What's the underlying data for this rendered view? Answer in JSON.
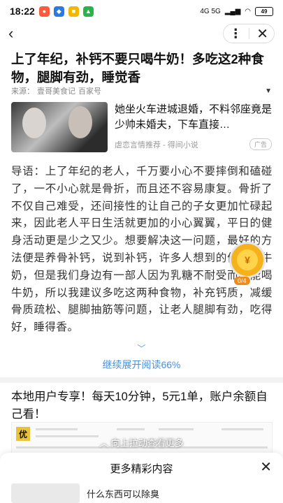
{
  "status_bar": {
    "time": "18:22",
    "network": "4G 5G",
    "battery": "49"
  },
  "nav": {
    "back_icon": "‹",
    "more_icon": "⋮",
    "close_icon": "✕"
  },
  "article": {
    "title": "上了年纪，补钙不要只喝牛奶！多吃这2种食物，腿脚有劲，睡觉香",
    "source_label": "来源：",
    "source_name": "壹哥美食记",
    "source_platform": "百家号"
  },
  "ad_card": {
    "headline": "她坐火车进城退婚，不料邻座竟是少帅未婚夫，下车直接…",
    "meta": "虐恋言情推荐 - 得间小说",
    "badge": "广告"
  },
  "body": {
    "text": "导语：上了年纪的老人，千万要小心不要摔倒和磕碰了，一不小心就是骨折，而且还不容易康复。骨折了不仅自己难受，还间接性的让自己的子女更加忙碌起来，因此老人平日生活就更加的小心翼翼，平日的健身活动更是少之又少。想要解决这一问题，最好的方法便是养骨补钙，说到补钙，许多人想到的便是喝牛奶，但是我们身边有一部人因为乳糖不耐受而不能喝牛奶，所以我建议多吃这两种食物，补充钙质，减缓骨质疏松、腿脚抽筋等问题，让老人腿脚有劲，吃得好，睡得香。"
  },
  "coin_widget": {
    "symbol": "¥",
    "progress_text": "0/4"
  },
  "expand": {
    "arrow": "﹀",
    "label": "继续展开阅读66%"
  },
  "ad2": {
    "title": "本地用户专享！每天10分钟，5元1单，账户余额自己看！",
    "logo": "优",
    "swipe_hint": "︿ 向上拉动查看更多"
  },
  "bottom_sheet": {
    "title": "更多精彩内容",
    "close_icon": "✕",
    "item_text": "什么东西可以除臭"
  }
}
